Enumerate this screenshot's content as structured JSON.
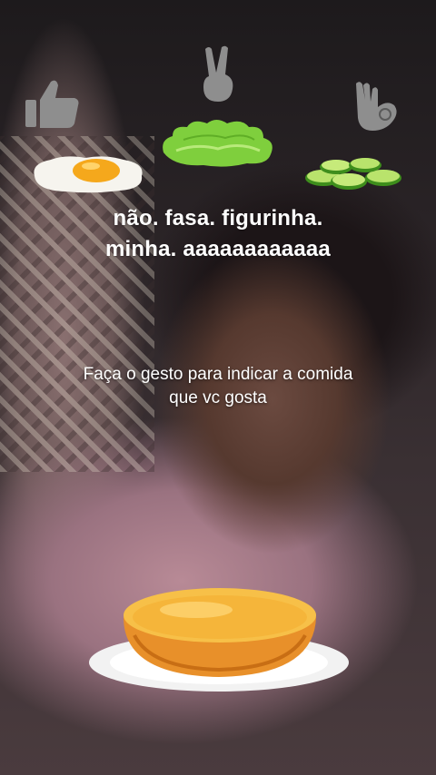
{
  "filter": {
    "gestures": [
      {
        "icon": "thumbs-up-icon",
        "food": "fried-egg"
      },
      {
        "icon": "peace-sign-icon",
        "food": "lettuce"
      },
      {
        "icon": "ok-hand-icon",
        "food": "cucumber-slices"
      }
    ],
    "caption_line1": "não.  fasa.  figurinha.",
    "caption_line2": "minha. aaaaaaaaaaaa",
    "instruction_line1": "Faça o gesto para indicar a comida",
    "instruction_line2": "que vc gosta",
    "bowl": "empty-bowl-on-plate"
  },
  "colors": {
    "icon_gray": "#8e8e8e",
    "text": "#ffffff",
    "bowl_orange": "#e8902a",
    "lettuce_green": "#7fcf3d",
    "egg_yolk": "#f5a81c"
  }
}
